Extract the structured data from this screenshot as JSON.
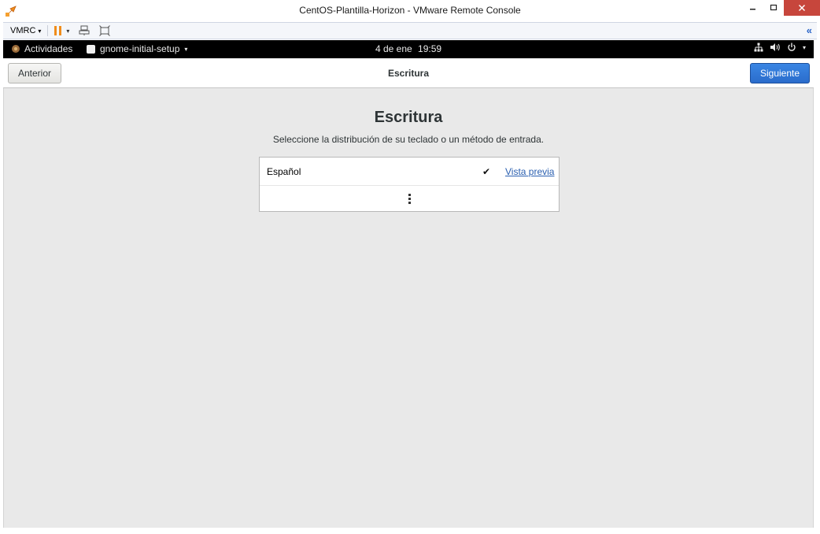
{
  "window": {
    "title": "CentOS-Plantilla-Horizon - VMware Remote Console"
  },
  "vmrc_toolbar": {
    "menu_label": "VMRC",
    "caret": "▾",
    "collapse": "«"
  },
  "gnome_bar": {
    "activities_label": "Actividades",
    "app_menu_label": "gnome-initial-setup",
    "caret": "▾",
    "clock_date": "4 de ene",
    "clock_time": "19:59"
  },
  "header": {
    "prev_label": "Anterior",
    "title": "Escritura",
    "next_label": "Siguiente"
  },
  "content": {
    "heading": "Escritura",
    "subtitle": "Seleccione la distribución de su teclado o un método de entrada.",
    "layouts": [
      {
        "name": "Español",
        "selected": true,
        "check": "✔",
        "preview_label": "Vista previa"
      }
    ]
  },
  "colors": {
    "accent": "#2a6ccb",
    "gnome_bar": "#000000",
    "content_bg": "#e9e9e9",
    "close_button": "#c7463c",
    "pause_icon": "#f08c1a",
    "link": "#2a5fb0"
  }
}
